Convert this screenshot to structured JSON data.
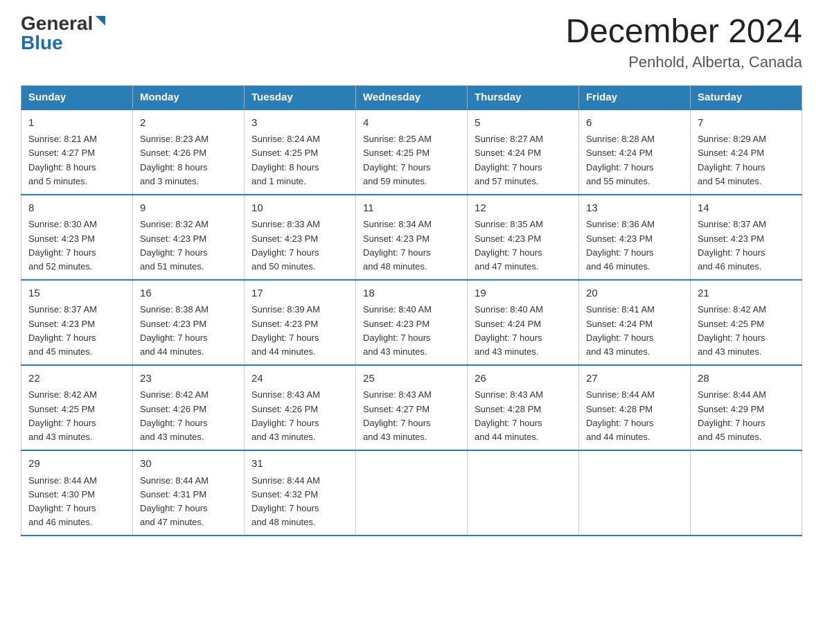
{
  "header": {
    "logo": {
      "general": "General",
      "blue": "Blue"
    },
    "title": "December 2024",
    "location": "Penhold, Alberta, Canada"
  },
  "days_of_week": [
    "Sunday",
    "Monday",
    "Tuesday",
    "Wednesday",
    "Thursday",
    "Friday",
    "Saturday"
  ],
  "weeks": [
    [
      {
        "day": "1",
        "sunrise": "8:21 AM",
        "sunset": "4:27 PM",
        "daylight": "8 hours and 5 minutes."
      },
      {
        "day": "2",
        "sunrise": "8:23 AM",
        "sunset": "4:26 PM",
        "daylight": "8 hours and 3 minutes."
      },
      {
        "day": "3",
        "sunrise": "8:24 AM",
        "sunset": "4:25 PM",
        "daylight": "8 hours and 1 minute."
      },
      {
        "day": "4",
        "sunrise": "8:25 AM",
        "sunset": "4:25 PM",
        "daylight": "7 hours and 59 minutes."
      },
      {
        "day": "5",
        "sunrise": "8:27 AM",
        "sunset": "4:24 PM",
        "daylight": "7 hours and 57 minutes."
      },
      {
        "day": "6",
        "sunrise": "8:28 AM",
        "sunset": "4:24 PM",
        "daylight": "7 hours and 55 minutes."
      },
      {
        "day": "7",
        "sunrise": "8:29 AM",
        "sunset": "4:24 PM",
        "daylight": "7 hours and 54 minutes."
      }
    ],
    [
      {
        "day": "8",
        "sunrise": "8:30 AM",
        "sunset": "4:23 PM",
        "daylight": "7 hours and 52 minutes."
      },
      {
        "day": "9",
        "sunrise": "8:32 AM",
        "sunset": "4:23 PM",
        "daylight": "7 hours and 51 minutes."
      },
      {
        "day": "10",
        "sunrise": "8:33 AM",
        "sunset": "4:23 PM",
        "daylight": "7 hours and 50 minutes."
      },
      {
        "day": "11",
        "sunrise": "8:34 AM",
        "sunset": "4:23 PM",
        "daylight": "7 hours and 48 minutes."
      },
      {
        "day": "12",
        "sunrise": "8:35 AM",
        "sunset": "4:23 PM",
        "daylight": "7 hours and 47 minutes."
      },
      {
        "day": "13",
        "sunrise": "8:36 AM",
        "sunset": "4:23 PM",
        "daylight": "7 hours and 46 minutes."
      },
      {
        "day": "14",
        "sunrise": "8:37 AM",
        "sunset": "4:23 PM",
        "daylight": "7 hours and 46 minutes."
      }
    ],
    [
      {
        "day": "15",
        "sunrise": "8:37 AM",
        "sunset": "4:23 PM",
        "daylight": "7 hours and 45 minutes."
      },
      {
        "day": "16",
        "sunrise": "8:38 AM",
        "sunset": "4:23 PM",
        "daylight": "7 hours and 44 minutes."
      },
      {
        "day": "17",
        "sunrise": "8:39 AM",
        "sunset": "4:23 PM",
        "daylight": "7 hours and 44 minutes."
      },
      {
        "day": "18",
        "sunrise": "8:40 AM",
        "sunset": "4:23 PM",
        "daylight": "7 hours and 43 minutes."
      },
      {
        "day": "19",
        "sunrise": "8:40 AM",
        "sunset": "4:24 PM",
        "daylight": "7 hours and 43 minutes."
      },
      {
        "day": "20",
        "sunrise": "8:41 AM",
        "sunset": "4:24 PM",
        "daylight": "7 hours and 43 minutes."
      },
      {
        "day": "21",
        "sunrise": "8:42 AM",
        "sunset": "4:25 PM",
        "daylight": "7 hours and 43 minutes."
      }
    ],
    [
      {
        "day": "22",
        "sunrise": "8:42 AM",
        "sunset": "4:25 PM",
        "daylight": "7 hours and 43 minutes."
      },
      {
        "day": "23",
        "sunrise": "8:42 AM",
        "sunset": "4:26 PM",
        "daylight": "7 hours and 43 minutes."
      },
      {
        "day": "24",
        "sunrise": "8:43 AM",
        "sunset": "4:26 PM",
        "daylight": "7 hours and 43 minutes."
      },
      {
        "day": "25",
        "sunrise": "8:43 AM",
        "sunset": "4:27 PM",
        "daylight": "7 hours and 43 minutes."
      },
      {
        "day": "26",
        "sunrise": "8:43 AM",
        "sunset": "4:28 PM",
        "daylight": "7 hours and 44 minutes."
      },
      {
        "day": "27",
        "sunrise": "8:44 AM",
        "sunset": "4:28 PM",
        "daylight": "7 hours and 44 minutes."
      },
      {
        "day": "28",
        "sunrise": "8:44 AM",
        "sunset": "4:29 PM",
        "daylight": "7 hours and 45 minutes."
      }
    ],
    [
      {
        "day": "29",
        "sunrise": "8:44 AM",
        "sunset": "4:30 PM",
        "daylight": "7 hours and 46 minutes."
      },
      {
        "day": "30",
        "sunrise": "8:44 AM",
        "sunset": "4:31 PM",
        "daylight": "7 hours and 47 minutes."
      },
      {
        "day": "31",
        "sunrise": "8:44 AM",
        "sunset": "4:32 PM",
        "daylight": "7 hours and 48 minutes."
      },
      null,
      null,
      null,
      null
    ]
  ],
  "labels": {
    "sunrise": "Sunrise:",
    "sunset": "Sunset:",
    "daylight": "Daylight:"
  }
}
